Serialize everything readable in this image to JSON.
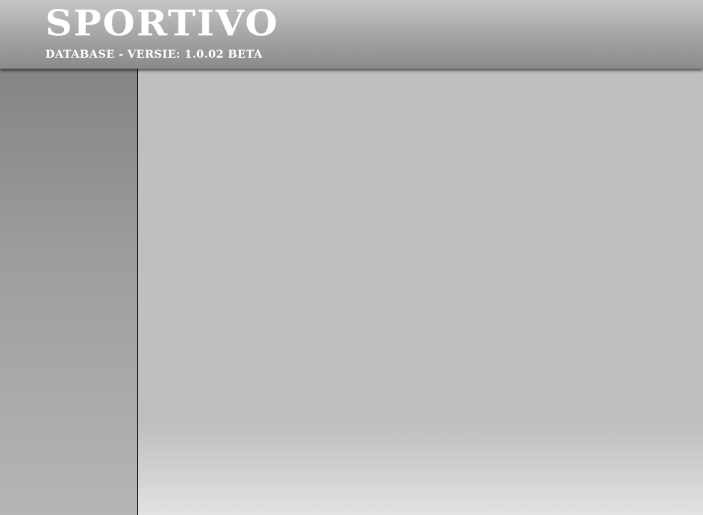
{
  "header": {
    "title": "SPORTIVO",
    "subtitle": "DATABASE - VERSIE: 1.0.02 BETA"
  },
  "sidebar": {
    "items": []
  },
  "main": {
    "content": ""
  },
  "colors": {
    "header_top": "#c6c6c6",
    "header_bottom": "#8a8a8a",
    "sidebar": "#9c9c9c",
    "content": "#bfbfbf",
    "brand_text": "#ffffff"
  }
}
